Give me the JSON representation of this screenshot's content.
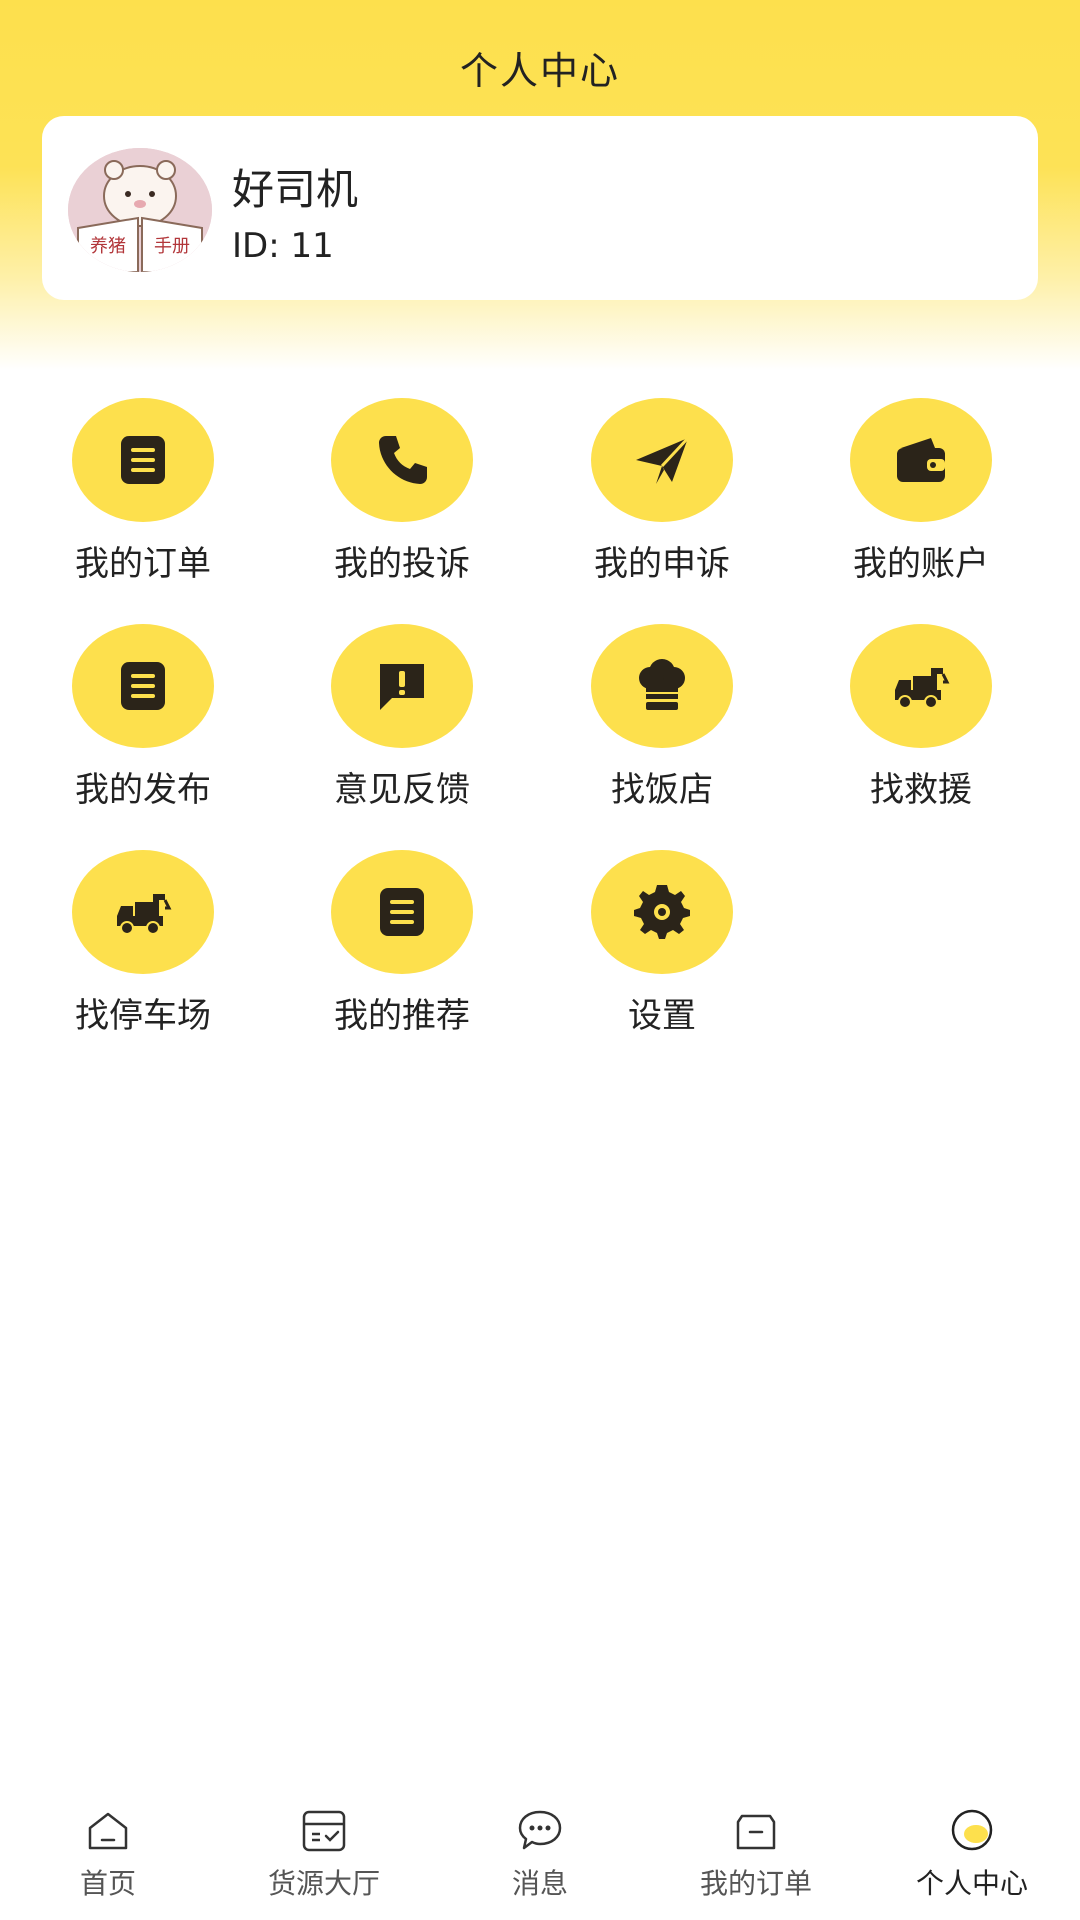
{
  "header": {
    "title": "个人中心"
  },
  "profile": {
    "name": "好司机",
    "id_text": "ID: 11",
    "avatar_caption": "养猪手册"
  },
  "menu": {
    "items": [
      {
        "label": "我的订单",
        "icon": "list-icon"
      },
      {
        "label": "我的投诉",
        "icon": "phone-icon"
      },
      {
        "label": "我的申诉",
        "icon": "paper-plane-icon"
      },
      {
        "label": "我的账户",
        "icon": "wallet-icon"
      },
      {
        "label": "我的发布",
        "icon": "list-icon"
      },
      {
        "label": "意见反馈",
        "icon": "feedback-icon"
      },
      {
        "label": "找饭店",
        "icon": "chef-hat-icon"
      },
      {
        "label": "找救援",
        "icon": "tow-truck-icon"
      },
      {
        "label": "找停车场",
        "icon": "tow-truck-icon"
      },
      {
        "label": "我的推荐",
        "icon": "list-icon"
      },
      {
        "label": "设置",
        "icon": "gear-icon"
      }
    ]
  },
  "tabbar": {
    "items": [
      {
        "label": "首页",
        "icon": "home-icon"
      },
      {
        "label": "货源大厅",
        "icon": "cargo-box-icon"
      },
      {
        "label": "消息",
        "icon": "chat-icon"
      },
      {
        "label": "我的订单",
        "icon": "order-icon"
      },
      {
        "label": "个人中心",
        "icon": "profile-face-icon",
        "active": true
      }
    ]
  },
  "colors": {
    "accent": "#fde04d",
    "icon_dark": "#2b2419",
    "text": "#222222"
  }
}
